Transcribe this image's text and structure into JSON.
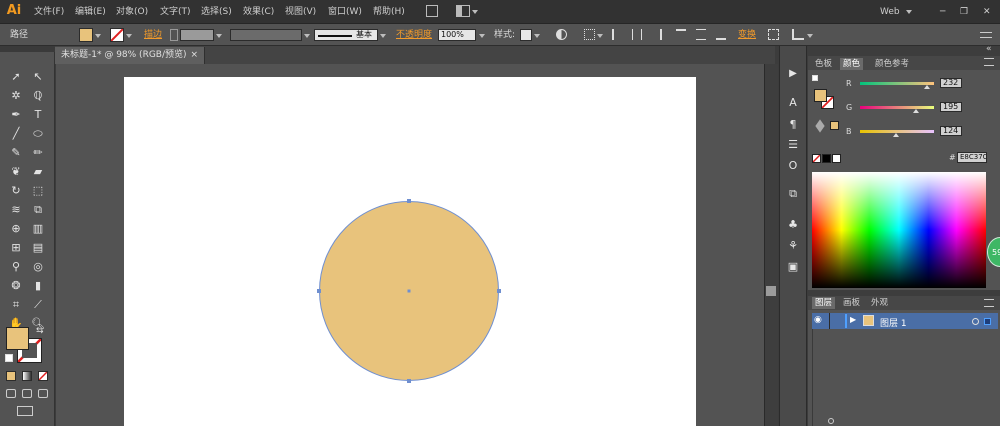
{
  "app": {
    "logo": "Ai",
    "workspace": "Web"
  },
  "menu": [
    "文件(F)",
    "编辑(E)",
    "对象(O)",
    "文字(T)",
    "选择(S)",
    "效果(C)",
    "视图(V)",
    "窗口(W)",
    "帮助(H)"
  ],
  "window_controls": {
    "minimize": "─",
    "restore": "❐",
    "close": "✕"
  },
  "control_bar": {
    "object_type": "路径",
    "stroke_label": "描边",
    "stroke_style": "基本",
    "opacity_label": "不透明度",
    "opacity_value": "100%",
    "style_label": "样式:",
    "transform_label": "变换"
  },
  "document_tab": {
    "title": "未标题-1* @ 98% (RGB/预览)",
    "close": "×"
  },
  "color_panel": {
    "tabs": [
      "色板",
      "颜色",
      "颜色参考"
    ],
    "active_tab": "颜色",
    "channels": [
      {
        "name": "R",
        "value": "232",
        "level": 0.91
      },
      {
        "name": "G",
        "value": "195",
        "level": 0.76
      },
      {
        "name": "B",
        "value": "124",
        "level": 0.49
      }
    ],
    "hex_label": "#",
    "hex_value": "E8C37C"
  },
  "layers_panel": {
    "tabs": [
      "图层",
      "画板",
      "外观"
    ],
    "active_tab": "图层",
    "layers": [
      {
        "name": "图层 1"
      }
    ]
  },
  "colors": {
    "fill": "#e8c37c",
    "circle_stroke": "#6f8fd0",
    "accent_orange": "#f39b2a",
    "badge_green": "#3eb765"
  },
  "badge": {
    "text": "59"
  }
}
